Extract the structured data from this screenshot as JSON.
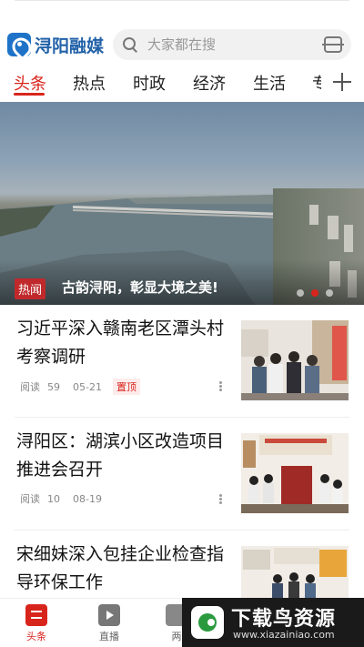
{
  "app": {
    "logo_text": "浔阳融媒"
  },
  "search": {
    "placeholder": "大家都在搜"
  },
  "tabs": [
    {
      "label": "头条"
    },
    {
      "label": "热点"
    },
    {
      "label": "时政"
    },
    {
      "label": "经济"
    },
    {
      "label": "生活"
    },
    {
      "label": "专"
    }
  ],
  "banner": {
    "badge": "热闻",
    "title": "古韵浔阳，彰显大境之美!",
    "slide_index": 2,
    "slide_count": 3
  },
  "news": [
    {
      "title": "习近平深入赣南老区潭头村考察调研",
      "read_label": "阅读",
      "reads": "59",
      "date": "05-21",
      "pin": "置顶"
    },
    {
      "title": "浔阳区：湖滨小区改造项目推进会召开",
      "read_label": "阅读",
      "reads": "10",
      "date": "08-19",
      "pin": ""
    },
    {
      "title": "宋细妹深入包挂企业检查指导环保工作",
      "read_label": "",
      "reads": "",
      "date": "",
      "pin": ""
    }
  ],
  "bottom_nav": [
    {
      "label": "头条",
      "icon": "headline-icon"
    },
    {
      "label": "直播",
      "icon": "tv-icon"
    },
    {
      "label": "两",
      "icon": "chat-icon"
    }
  ],
  "watermark": {
    "title": "下载鸟资源",
    "url": "www.xiazainiao.com"
  },
  "colors": {
    "accent": "#d8251c",
    "brand": "#2262a8"
  }
}
